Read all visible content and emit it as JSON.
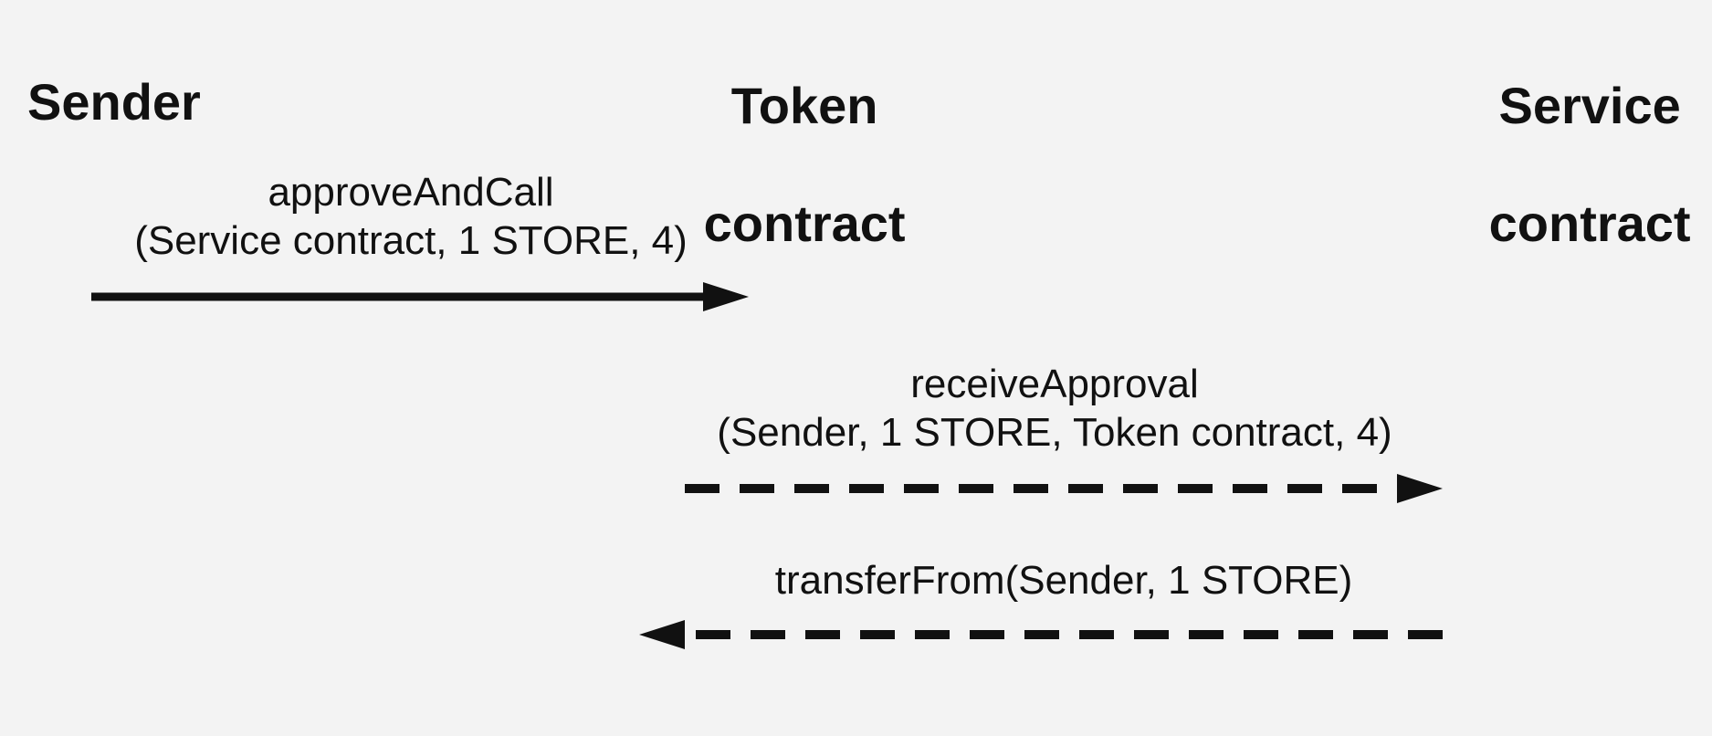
{
  "actors": {
    "sender": "Sender",
    "token_line1": "Token",
    "token_line2": "contract",
    "service_line1": "Service",
    "service_line2": "contract"
  },
  "messages": {
    "m1_line1": "approveAndCall",
    "m1_line2": "(Service contract, 1 STORE, 4)",
    "m2_line1": "receiveApproval",
    "m2_line2": "(Sender, 1 STORE, Token contract, 4)",
    "m3_line1": "transferFrom(Sender, 1 STORE)"
  }
}
